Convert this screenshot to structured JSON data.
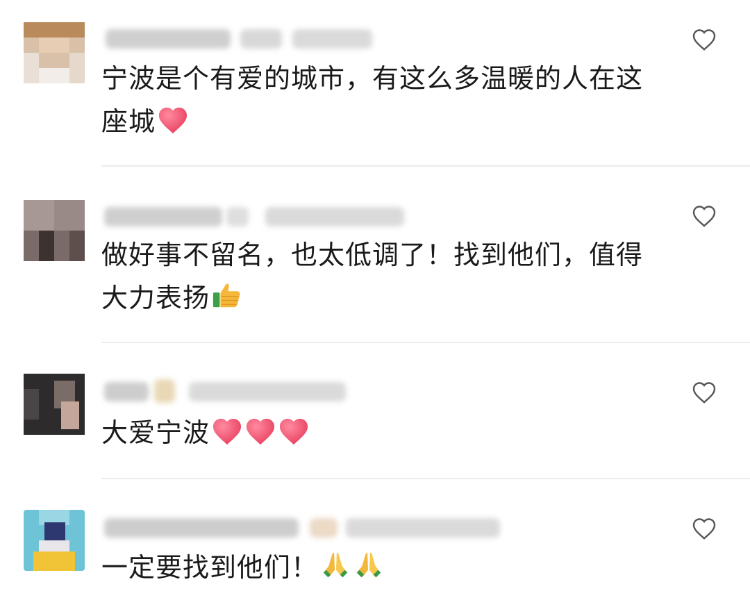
{
  "comments": [
    {
      "text_line1": "宁波是个有爱的城市，有这么多温暖的人在这",
      "text_line2": "座城",
      "emoji": "red-heart-icon",
      "emoji_count": 1,
      "like_icon": "heart-outline-icon"
    },
    {
      "text_line1": "做好事不留名，也太低调了！找到他们，值得",
      "text_line2": "大力表扬",
      "emoji": "thumbs-up-icon",
      "emoji_count": 1,
      "like_icon": "heart-outline-icon"
    },
    {
      "text_line1": "大爱宁波",
      "text_line2": "",
      "emoji": "red-heart-icon",
      "emoji_count": 3,
      "like_icon": "heart-outline-icon"
    },
    {
      "text_line1": "一定要找到他们！",
      "text_line2": "",
      "emoji": "folded-hands-icon",
      "emoji_count": 2,
      "like_icon": "heart-outline-icon"
    }
  ],
  "colors": {
    "text": "#1a1a1a",
    "divider": "#ececec",
    "heart_emoji": "#f4506a",
    "like_outline": "#555555",
    "blur_text": "#c8c8c8"
  }
}
